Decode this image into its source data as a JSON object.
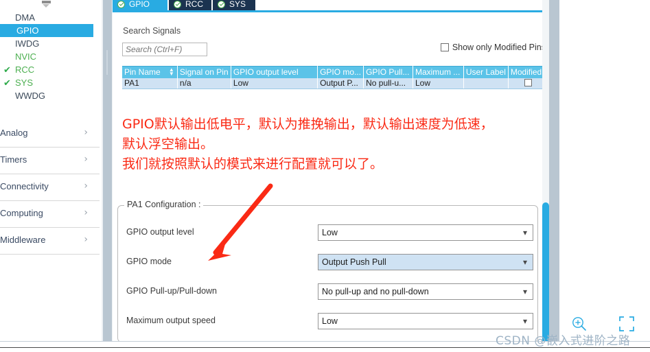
{
  "sidebar": {
    "scroll_up_icon": "scroll-up-arrow-icon",
    "peripherals": [
      {
        "label": "DMA",
        "state": "normal",
        "checked": false
      },
      {
        "label": "GPIO",
        "state": "selected",
        "checked": false
      },
      {
        "label": "IWDG",
        "state": "normal",
        "checked": false
      },
      {
        "label": "NVIC",
        "state": "configured",
        "checked": false
      },
      {
        "label": "RCC",
        "state": "configured",
        "checked": true
      },
      {
        "label": "SYS",
        "state": "configured",
        "checked": true
      },
      {
        "label": "WWDG",
        "state": "normal",
        "checked": false
      }
    ],
    "categories": [
      {
        "label": "Analog",
        "chevron": "chevron-right-icon"
      },
      {
        "label": "Timers",
        "chevron": "chevron-right-icon"
      },
      {
        "label": "Connectivity",
        "chevron": "chevron-right-icon"
      },
      {
        "label": "Computing",
        "chevron": "chevron-right-icon"
      },
      {
        "label": "Middleware",
        "chevron": "chevron-right-icon"
      }
    ]
  },
  "tabs": [
    {
      "label": "GPIO",
      "active": true,
      "status_icon": "green-check-icon"
    },
    {
      "label": "RCC",
      "active": false,
      "status_icon": "green-check-icon"
    },
    {
      "label": "SYS",
      "active": false,
      "status_icon": "green-check-icon"
    }
  ],
  "search": {
    "title": "Search Signals",
    "placeholder": "Search (Ctrl+F)",
    "value": "",
    "show_modified_label": "Show only Modified Pins",
    "show_modified_checked": false
  },
  "signal_table": {
    "columns": [
      "Pin Name",
      "Signal on Pin",
      "GPIO output level",
      "GPIO mo...",
      "GPIO Pull...",
      "Maximum ...",
      "User Label",
      "Modified"
    ],
    "sort_column": "Pin Name",
    "sort_icon": "sort-updown-icon",
    "rows": [
      {
        "pin_name": "PA1",
        "signal_on_pin": "n/a",
        "gpio_output_level": "Low",
        "gpio_mode": "Output P...",
        "gpio_pull": "No pull-u...",
        "maximum": "Low",
        "user_label": "",
        "modified": false,
        "selected": true
      }
    ]
  },
  "annotation": {
    "line1": "GPIO默认输出低电平，默认为推挽输出，默认输出速度为低速，",
    "line2": "默认浮空输出。",
    "line3": "我们就按照默认的模式来进行配置就可以了。",
    "color": "#fa2a15",
    "arrow": "red-arrow-pointer"
  },
  "config_panel": {
    "legend": "PA1 Configuration :",
    "rows": [
      {
        "label": "GPIO output level",
        "value": "Low",
        "highlighted": false,
        "chevron": "chevron-down-icon"
      },
      {
        "label": "GPIO mode",
        "value": "Output Push Pull",
        "highlighted": true,
        "chevron": "chevron-down-icon"
      },
      {
        "label": "GPIO Pull-up/Pull-down",
        "value": "No pull-up and no pull-down",
        "highlighted": false,
        "chevron": "chevron-down-icon"
      },
      {
        "label": "Maximum output speed",
        "value": "Low",
        "highlighted": false,
        "chevron": "chevron-down-icon"
      }
    ]
  },
  "overlay": {
    "zoom_icon": "zoom-in-icon",
    "fullscreen_icon": "fullscreen-icon",
    "watermark": "CSDN @嵌入式进阶之路"
  },
  "colors": {
    "accent_blue": "#29abe2",
    "tab_inactive": "#1b3350",
    "table_header": "#5bc3e8",
    "row_selected": "#cfe2f3",
    "annotation_red": "#fa2a15",
    "check_green": "#2eaa4a",
    "watermark": "#9fb4c6"
  }
}
